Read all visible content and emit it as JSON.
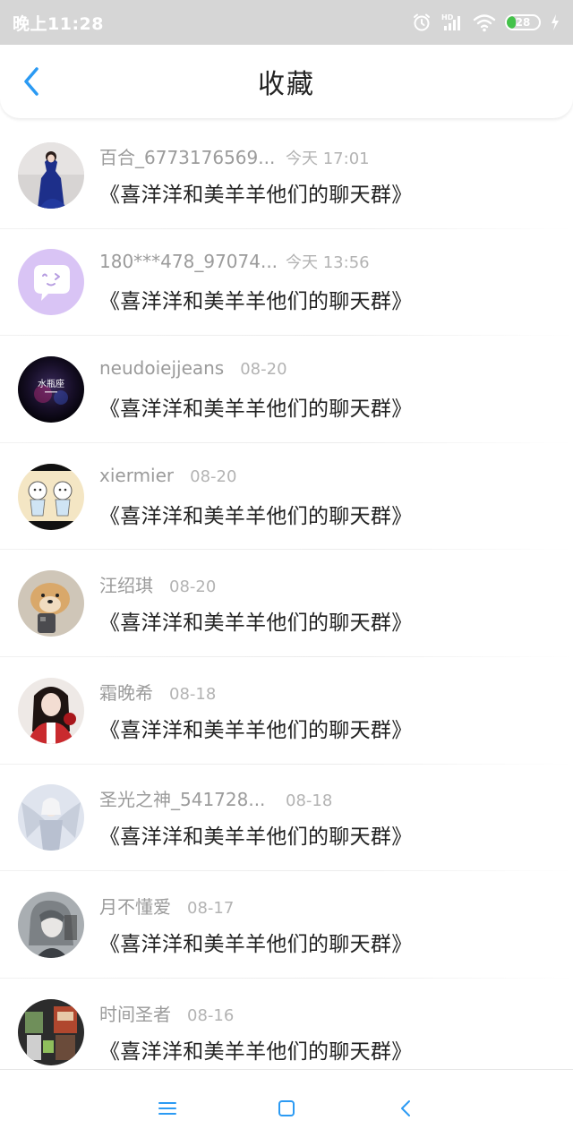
{
  "status_bar": {
    "time": "晚上11:28",
    "battery": "28",
    "battery_level": 0.28,
    "icons": [
      "alarm-icon",
      "signal-hd-icon",
      "wifi-icon",
      "battery-icon",
      "charging-icon"
    ]
  },
  "header": {
    "title": "收藏",
    "back_icon": "chevron-left-icon",
    "accent_color": "#2b9af3"
  },
  "favorites": [
    {
      "username": "百合_6773176569...",
      "time": "今天 17:01",
      "title": "《喜洋洋和美羊羊他们的聊天群》"
    },
    {
      "username": "180***478_97074...",
      "time": "今天 13:56",
      "title": "《喜洋洋和美羊羊他们的聊天群》"
    },
    {
      "username": "neudoiejjeans",
      "time": "08-20",
      "title": "《喜洋洋和美羊羊他们的聊天群》"
    },
    {
      "username": "xiermier",
      "time": "08-20",
      "title": "《喜洋洋和美羊羊他们的聊天群》"
    },
    {
      "username": "汪绍琪",
      "time": "08-20",
      "title": "《喜洋洋和美羊羊他们的聊天群》"
    },
    {
      "username": "霜晚希",
      "time": "08-18",
      "title": "《喜洋洋和美羊羊他们的聊天群》"
    },
    {
      "username": "圣光之神_541728...",
      "time": "08-18",
      "title": "《喜洋洋和美羊羊他们的聊天群》"
    },
    {
      "username": "月不懂爱",
      "time": "08-17",
      "title": "《喜洋洋和美羊羊他们的聊天群》"
    },
    {
      "username": "时间圣者",
      "time": "08-16",
      "title": "《喜洋洋和美羊羊他们的聊天群》"
    }
  ],
  "avatars": {
    "row3_text": "水瓶座"
  },
  "nav_bar": {
    "icons": [
      "menu-icon",
      "home-square-icon",
      "back-triangle-icon"
    ],
    "color": "#2b9af3"
  }
}
